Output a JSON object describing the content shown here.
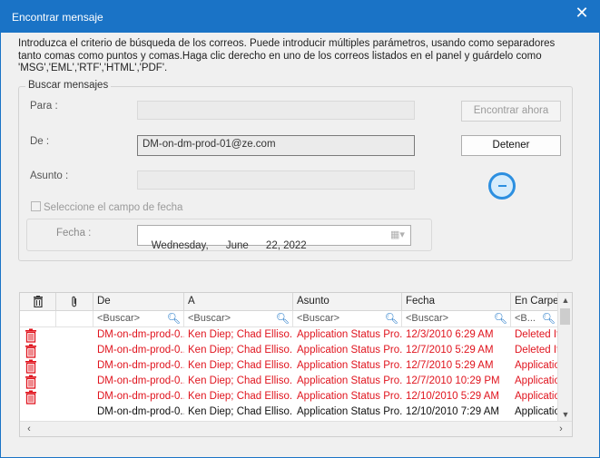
{
  "window": {
    "title": "Encontrar mensaje",
    "close_symbol": "✕"
  },
  "intro_text": "Introduzca el criterio de búsqueda de los correos. Puede introducir múltiples parámetros, usando como separadores tanto comas como puntos y comas.Haga clic derecho en uno de los correos listados en el panel y guárdelo como 'MSG','EML','RTF','HTML','PDF'.",
  "search": {
    "group_label": "Buscar mensajes",
    "to_label": "Para :",
    "to_value": "",
    "from_label": "De :",
    "from_value": "DM-on-dm-prod-01@ze.com",
    "subject_label": "Asunto :",
    "subject_value": "",
    "date_checkbox_label": "Seleccione el campo de fecha",
    "date_checked": false,
    "date_label": "Fecha :",
    "date_value": "Wednesday,      June      22, 2022",
    "find_button": "Encontrar ahora",
    "stop_button": "Detener"
  },
  "results": {
    "columns": [
      "",
      "",
      "De",
      "A",
      "Asunto",
      "Fecha",
      "En Carpet"
    ],
    "search_placeholder": "<Buscar>",
    "search_placeholder_short": "<B...",
    "rows": [
      {
        "deleted": true,
        "from": "DM-on-dm-prod-0...",
        "to": "Ken Diep; Chad Elliso...",
        "subject": "Application Status Pro...",
        "date": "12/3/2010 6:29 AM",
        "folder": "Deleted It"
      },
      {
        "deleted": true,
        "from": "DM-on-dm-prod-0...",
        "to": "Ken Diep; Chad Elliso...",
        "subject": "Application Status Pro...",
        "date": "12/7/2010 5:29 AM",
        "folder": "Deleted It"
      },
      {
        "deleted": true,
        "from": "DM-on-dm-prod-0...",
        "to": "Ken Diep; Chad Elliso...",
        "subject": "Application Status Pro...",
        "date": "12/7/2010 5:29 AM",
        "folder": "Applicatio"
      },
      {
        "deleted": true,
        "from": "DM-on-dm-prod-0...",
        "to": "Ken Diep; Chad Elliso...",
        "subject": "Application Status Pro...",
        "date": "12/7/2010 10:29 PM",
        "folder": "Applicatio"
      },
      {
        "deleted": true,
        "from": "DM-on-dm-prod-0...",
        "to": "Ken Diep; Chad Elliso...",
        "subject": "Application Status Pro...",
        "date": "12/10/2010 5:29 AM",
        "folder": "Applicatio"
      },
      {
        "deleted": false,
        "from": "DM-on-dm-prod-0...",
        "to": "Ken Diep; Chad Elliso...",
        "subject": "Application Status Pro...",
        "date": "12/10/2010 7:29 AM",
        "folder": "Applicatio"
      }
    ]
  },
  "colors": {
    "accent": "#1a73c6",
    "deleted_text": "#e0141e"
  },
  "icons": {
    "header_delete": "trash-icon",
    "header_attachment": "paperclip-icon",
    "row_deleted": "trash-icon",
    "search": "magnifier-icon"
  }
}
